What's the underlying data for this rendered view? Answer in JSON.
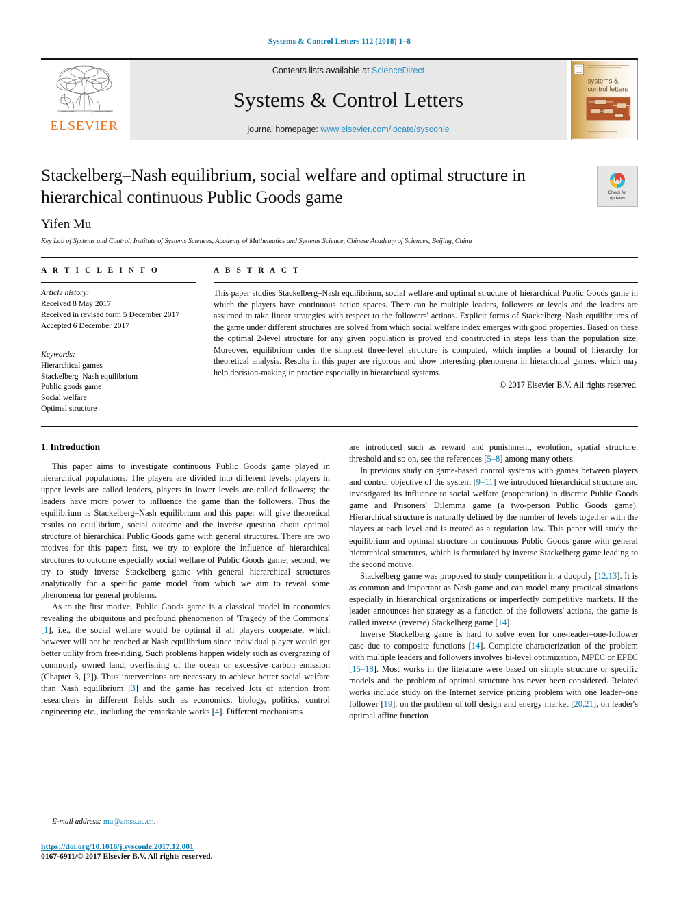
{
  "running_head": "Systems & Control Letters 112 (2018) 1–8",
  "masthead": {
    "publisher_name": "ELSEVIER",
    "contents_prefix": "Contents lists available at ",
    "contents_link": "ScienceDirect",
    "journal_title": "Systems & Control Letters",
    "homepage_prefix": "journal homepage: ",
    "homepage_url": "www.elsevier.com/locate/sysconle",
    "cover_title_line1": "systems &",
    "cover_title_line2": "control letters"
  },
  "article": {
    "title": "Stackelberg–Nash equilibrium, social welfare and optimal structure in hierarchical continuous Public Goods game",
    "author": "Yifen Mu",
    "affiliation": "Key Lab of Systems and Control, Institute of Systems Sciences, Academy of Mathematics and Systems Science, Chinese Academy of Sciences, Beijing, China",
    "crossmark_line1": "Check for",
    "crossmark_line2": "updates"
  },
  "article_info": {
    "heading": "A R T I C L E   I N F O",
    "history_label": "Article history:",
    "history": [
      "Received 8 May 2017",
      "Received in revised form 5 December 2017",
      "Accepted 6 December 2017"
    ],
    "keywords_label": "Keywords:",
    "keywords": [
      "Hierarchical games",
      "Stackelberg–Nash equilibrium",
      "Public goods game",
      "Social welfare",
      "Optimal structure"
    ]
  },
  "abstract": {
    "heading": "A B S T R A C T",
    "text": "This paper studies Stackelberg–Nash equilibrium, social welfare and optimal structure of hierarchical Public Goods game in which the players have continuous action spaces. There can be multiple leaders, followers or levels and the leaders are assumed to take linear strategies with respect to the followers' actions. Explicit forms of Stackelberg–Nash equilibriums of the game under different structures are solved from which social welfare index emerges with good properties. Based on these the optimal 2-level structure for any given population is proved and constructed in steps less than the population size. Moreover, equilibrium under the simplest three-level structure is computed, which implies a bound of hierarchy for theoretical analysis. Results in this paper are rigorous and show interesting phenomena in hierarchical games, which may help decision-making in practice especially in hierarchical systems.",
    "copyright": "© 2017 Elsevier B.V. All rights reserved."
  },
  "body": {
    "section_heading": "1. Introduction",
    "left_paragraphs": [
      "This paper aims to investigate continuous Public Goods game played in hierarchical populations. The players are divided into different levels: players in upper levels are called leaders, players in lower levels are called followers; the leaders have more power to influence the game than the followers. Thus the equilibrium is Stackelberg–Nash equilibrium and this paper will give theoretical results on equilibrium, social outcome and the inverse question about optimal structure of hierarchical Public Goods game with general structures. There are two motives for this paper: first, we try to explore the influence of hierarchical structures to outcome especially social welfare of Public Goods game; second, we try to study inverse Stackelberg game with general hierarchical structures analytically for a specific game model from which we aim to reveal some phenomena for general problems.",
      "As to the first motive, Public Goods game is a classical model in economics revealing the ubiquitous and profound phenomenon of 'Tragedy of the Commons' [1], i.e., the social welfare would be optimal if all players cooperate, which however will not be reached at Nash equilibrium since individual player would get better utility from free-riding. Such problems happen widely such as overgrazing of commonly owned land, overfishing of the ocean or excessive carbon emission (Chapter 3, [2]). Thus interventions are necessary to achieve better social welfare than Nash equilibrium [3] and the game has received lots of attention from researchers in different fields such as economics, biology, politics, control engineering etc., including the remarkable works [4]. Different mechanisms"
    ],
    "right_paragraphs": [
      "are introduced such as reward and punishment, evolution, spatial structure, threshold and so on, see the references [5–8] among many others.",
      "In previous study on game-based control systems with games between players and control objective of the system [9–11] we introduced hierarchical structure and investigated its influence to social welfare (cooperation) in discrete Public Goods game and Prisoners' Dilemma game (a two-person Public Goods game). Hierarchical structure is naturally defined by the number of levels together with the players at each level and is treated as a regulation law. This paper will study the equilibrium and optimal structure in continuous Public Goods game with general hierarchical structures, which is formulated by inverse Stackelberg game leading to the second motive.",
      "Stackelberg game was proposed to study competition in a duopoly [12,13]. It is as common and important as Nash game and can model many practical situations especially in hierarchical organizations or imperfectly competitive markets. If the leader announces her strategy as a function of the followers' actions, the game is called inverse (reverse) Stackelberg game [14].",
      "Inverse Stackelberg game is hard to solve even for one-leader–one-follower case due to composite functions [14]. Complete characterization of the problem with multiple leaders and followers involves bi-level optimization, MPEC or EPEC [15–18]. Most works in the literature were based on simple structure or specific models and the problem of optimal structure has never been considered. Related works include study on the Internet service pricing problem with one leader–one follower [19], on the problem of toll design and energy market [20,21], on leader's optimal affine function"
    ]
  },
  "footer": {
    "email_label": "E-mail address:",
    "email": "mu@amss.ac.cn",
    "email_suffix": ".",
    "doi": "https://doi.org/10.1016/j.sysconle.2017.12.001",
    "issn_copyright": "0167-6911/© 2017 Elsevier B.V. All rights reserved."
  },
  "colors": {
    "link": "#0b7cb0",
    "sciencedirect": "#2b8fc4",
    "elsevier_orange": "#e87722",
    "masthead_bg": "#e8e8e8"
  }
}
